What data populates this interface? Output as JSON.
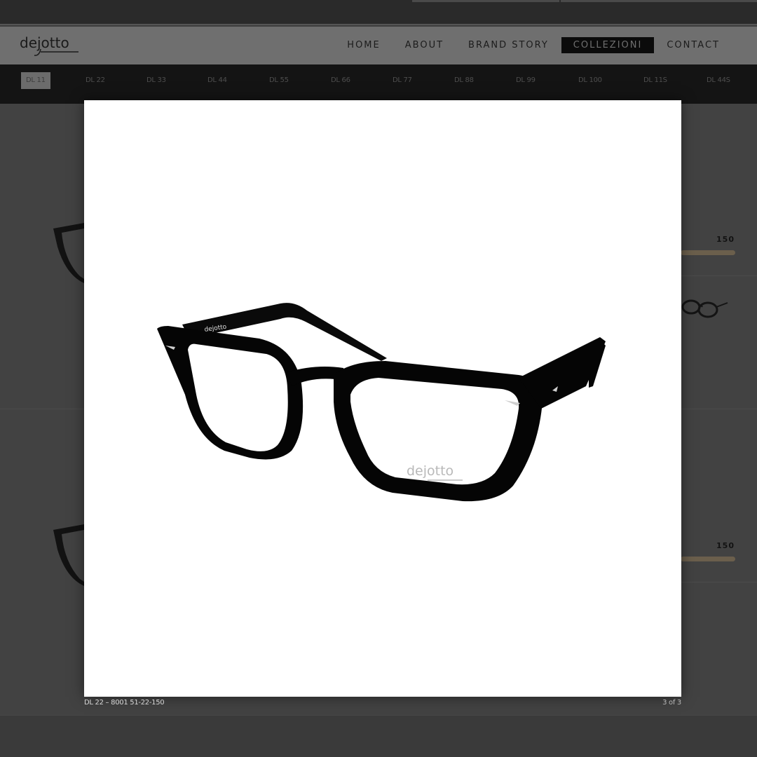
{
  "brand": {
    "logo_text": "dejotto"
  },
  "nav": {
    "items": [
      {
        "label": "HOME",
        "active": false
      },
      {
        "label": "ABOUT",
        "active": false
      },
      {
        "label": "BRAND STORY",
        "active": false
      },
      {
        "label": "COLLEZIONI",
        "active": true
      },
      {
        "label": "CONTACT",
        "active": false
      }
    ]
  },
  "collections": {
    "items": [
      {
        "label": "DL 11",
        "active": true
      },
      {
        "label": "DL 22",
        "active": false
      },
      {
        "label": "DL 33",
        "active": false
      },
      {
        "label": "DL 44",
        "active": false
      },
      {
        "label": "DL 55",
        "active": false
      },
      {
        "label": "DL 66",
        "active": false
      },
      {
        "label": "DL 77",
        "active": false
      },
      {
        "label": "DL 88",
        "active": false
      },
      {
        "label": "DL 99",
        "active": false
      },
      {
        "label": "DL 100",
        "active": false
      },
      {
        "label": "DL 11S",
        "active": false
      },
      {
        "label": "DL 44S",
        "active": false
      }
    ]
  },
  "background_products": [
    {
      "price": "150"
    },
    {
      "price": "150"
    }
  ],
  "lightbox": {
    "product_logo": "dejotto",
    "temple_logo": "dejotto",
    "caption": "DL 22 – 8001 51-22-150",
    "counter": "3 of 3"
  },
  "colors": {
    "nav_active_bg": "#0b0b0b",
    "header_bg": "#6f6f6f",
    "subnav_bg": "#141414",
    "overlay_bg": "#424242",
    "lightbox_bg": "#ffffff",
    "price_bar": "#6b5f4c"
  }
}
